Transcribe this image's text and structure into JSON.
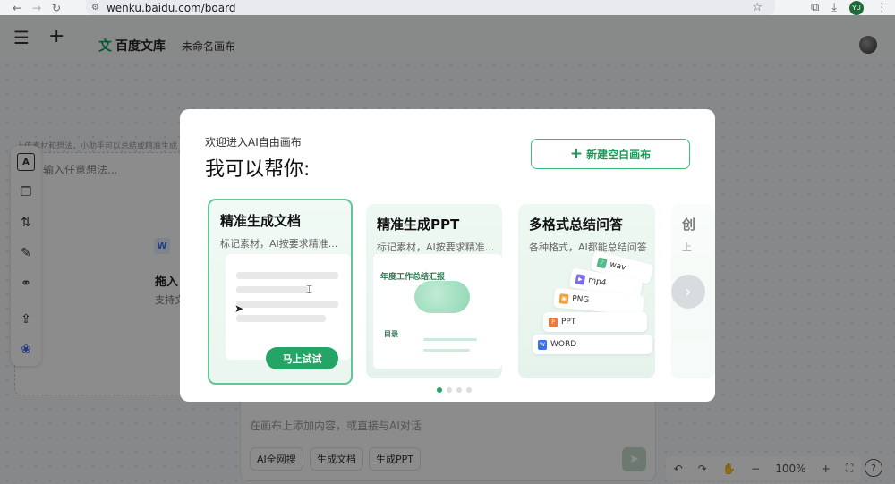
{
  "browser": {
    "url": "wenku.baidu.com/board",
    "profile_initials": "YU"
  },
  "header": {
    "logo_mark": "文",
    "logo_text": "百度文库",
    "canvas_title": "未命名画布"
  },
  "background": {
    "hint": "上传素材和想法，小助手可以总结或精准生成",
    "input_placeholder": "输入任意想法...",
    "drop_title": "拖入",
    "drop_subtitle": "支持文",
    "w_badge": "W"
  },
  "chat": {
    "placeholder": "在画布上添加内容，或直接与AI对话",
    "chips": [
      "AI全网搜",
      "生成文档",
      "生成PPT"
    ]
  },
  "zoom": {
    "level": "100%"
  },
  "modal": {
    "welcome": "欢迎进入AI自由画布",
    "heading": "我可以帮你:",
    "new_button": "新建空白画布",
    "cards": [
      {
        "title": "精准生成文档",
        "subtitle": "标记素材，AI按要求精准...",
        "button": "马上试试"
      },
      {
        "title": "精准生成PPT",
        "subtitle": "标记素材，AI按要求精准...",
        "ppt_title": "年度工作总结汇报",
        "toc_label": "目录"
      },
      {
        "title": "多格式总结问答",
        "subtitle": "各种格式，AI都能总结问答",
        "formats": [
          "wav",
          "mp4",
          "PNG",
          "PPT",
          "WORD"
        ]
      },
      {
        "title": "创",
        "subtitle": "上"
      }
    ],
    "active_page": 1,
    "page_count": 4
  },
  "colors": {
    "accent": "#24a565",
    "accent_border": "#63c692"
  }
}
